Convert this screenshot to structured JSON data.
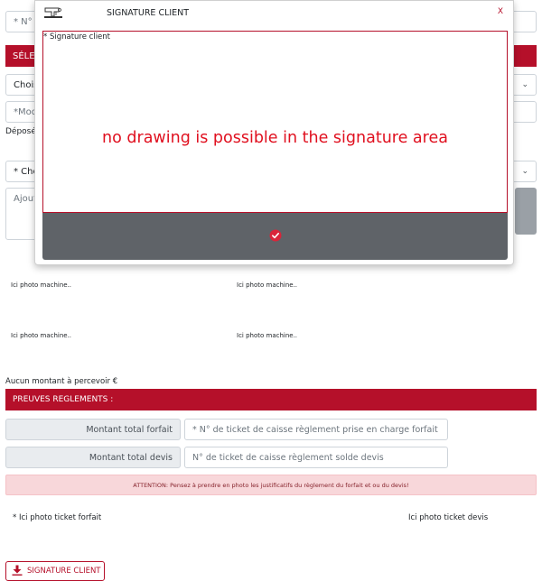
{
  "background_form": {
    "serial_field_placeholder": "* N° d",
    "selection_bar_label": "SÉLEC",
    "choose_select_value": "Chois",
    "model_placeholder": "*Mode",
    "depose_label": "Déposé",
    "choose_select2_value": "* Cho",
    "add_textarea_placeholder": "Ajoute",
    "photo_labels": [
      "Ici photo machine..",
      "Ici photo machine..",
      "Ici photo machine..",
      "Ici photo machine.."
    ],
    "no_amount_text": "Aucun montant à percevoir €",
    "proofs_bar_label": "PREUVES REGLEMENTS :",
    "forfait_total_label": "Montant total forfait",
    "forfait_ticket_placeholder": "* N° de ticket de caisse règlement prise en charge forfait",
    "devis_total_label": "Montant total devis",
    "devis_ticket_placeholder": "N° de ticket de caisse règlement solde devis",
    "attention_text": "ATTENTION: Pensez à prendre en photo les justificatifs du règlement du forfait et ou du devis!",
    "photo_ticket_forfait": "* Ici photo ticket forfait",
    "photo_ticket_devis": "Ici photo ticket devis",
    "signature_button_label": "SIGNATURE CLIENT"
  },
  "modal": {
    "title": "SIGNATURE CLIENT",
    "close_glyph": "X",
    "signature_field_label": "* Signature client",
    "overlay_message": "no drawing is possible in the signature area"
  },
  "colors": {
    "brand_red": "#b5102a",
    "message_red": "#e0101f",
    "validate_bar": "#5f6368"
  },
  "icons": {
    "modal_logo": "sewing-machine-icon",
    "close": "close-icon",
    "validate": "check-circle-icon",
    "download": "download-icon",
    "select_chevron": "chevron-down-icon"
  }
}
